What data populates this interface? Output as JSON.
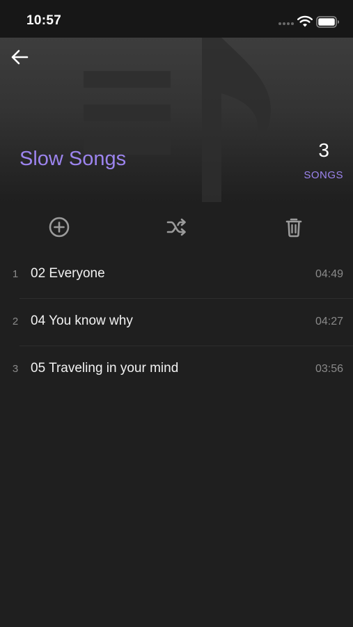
{
  "status_bar": {
    "time": "10:57"
  },
  "header": {
    "back_icon": "arrow-left-icon",
    "title": "Slow Songs",
    "song_count": "3",
    "song_count_label": "SONGS"
  },
  "actions": {
    "add_icon": "plus-circle-icon",
    "shuffle_icon": "shuffle-icon",
    "delete_icon": "trash-icon"
  },
  "tracks": [
    {
      "number": "1",
      "title": "02 Everyone",
      "duration": "04:49"
    },
    {
      "number": "2",
      "title": "04 You know why",
      "duration": "04:27"
    },
    {
      "number": "3",
      "title": "05 Traveling in your mind",
      "duration": "03:56"
    }
  ],
  "colors": {
    "accent": "#9c84ee",
    "background": "#1f1f1f",
    "muted_text": "#8a8a8a"
  }
}
